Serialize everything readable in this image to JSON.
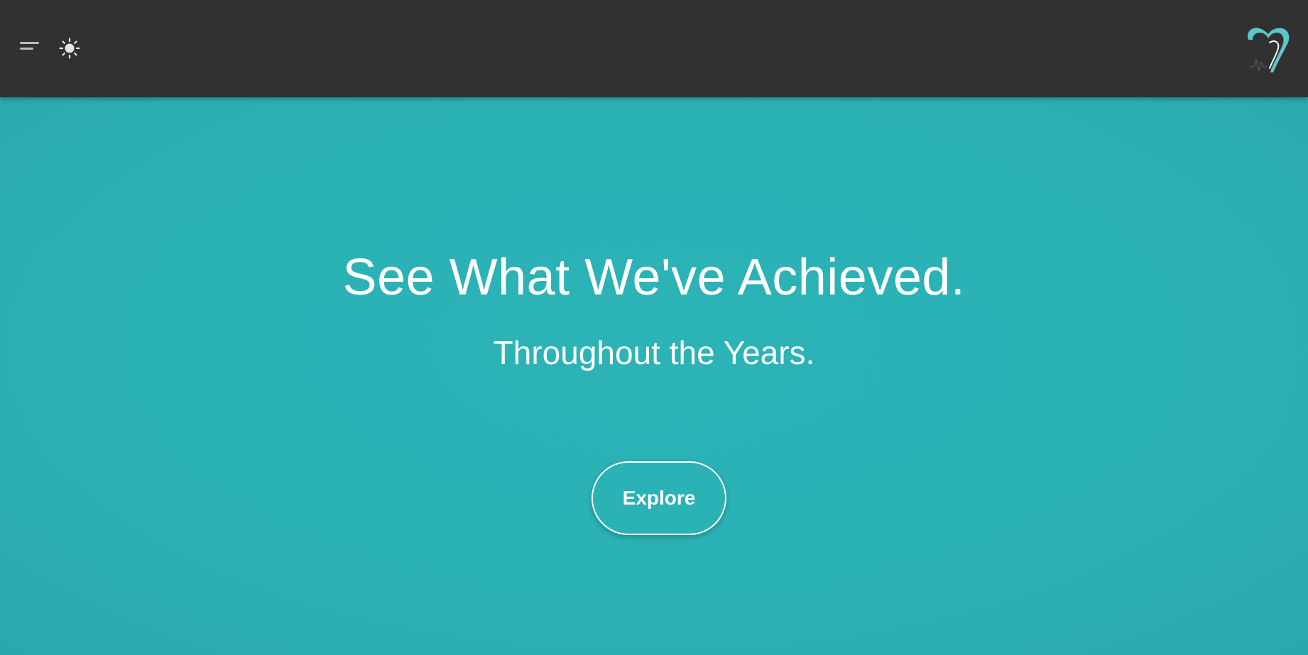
{
  "header": {
    "menu_icon": "menu-icon",
    "theme_icon": "sun-icon",
    "logo_icon": "heart-pulse-logo",
    "bg_color": "#313131",
    "logo_color": "#5bc7c8"
  },
  "hero": {
    "title": "See What We've Achieved.",
    "subtitle": "Throughout the Years.",
    "button_label": "Explore",
    "bg_color": "#2bb2b5",
    "text_color": "#ffffff"
  }
}
